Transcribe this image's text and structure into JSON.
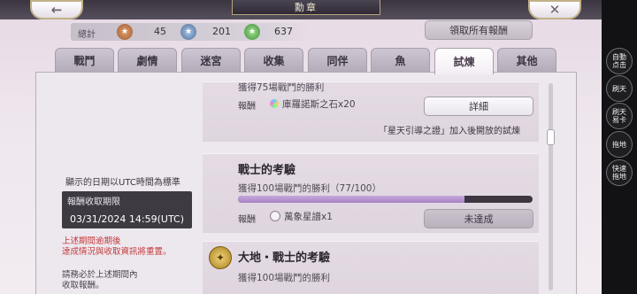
{
  "header": {
    "back_icon": "←",
    "title": "勳章",
    "close_icon": "✕"
  },
  "totals": {
    "label": "總計",
    "bronze": "45",
    "silver": "201",
    "gold": "637"
  },
  "claim_all_label": "領取所有報酬",
  "tabs": [
    {
      "label": "戰鬥",
      "active": false
    },
    {
      "label": "劇情",
      "active": false
    },
    {
      "label": "迷宮",
      "active": false
    },
    {
      "label": "收集",
      "active": false
    },
    {
      "label": "同伴",
      "active": false
    },
    {
      "label": "魚",
      "active": false
    },
    {
      "label": "試煉",
      "active": true
    },
    {
      "label": "其他",
      "active": false
    }
  ],
  "info": {
    "utc_note": "顯示的日期以UTC時間為標準",
    "deadline_title": "報酬收取期限",
    "deadline_date": "03/31/2024 14:59(UTC)",
    "warning_line1": "上述期間逾期後",
    "warning_line2": "達成情況與收取資訊將重置。",
    "note_line1": "請務必於上述期間內",
    "note_line2": "收取報酬。"
  },
  "achievements": [
    {
      "title": "",
      "desc": "獲得75場戰鬥的勝利",
      "reward_label": "報酬",
      "reward": "庫羅諾斯之石x20",
      "button": "詳細",
      "note": "「星天引導之證」加入後開放的試煉"
    },
    {
      "title": "戰士的考驗",
      "desc": "獲得100場戰鬥的勝利（77/100）",
      "progress": 0.77,
      "reward_label": "報酬",
      "reward": "萬象星譜x1",
      "button": "未達成"
    },
    {
      "title": "大地・戰士的考驗",
      "desc": "獲得100場戰鬥的勝利"
    }
  ],
  "side_buttons": [
    "自動\n点击",
    "刷天",
    "刷天\n易卡",
    "拖地",
    "快速\n拖地"
  ],
  "colors": {
    "accent": "#a882c4",
    "warning": "#c23a3a",
    "frame_gold": "#c2b187"
  }
}
